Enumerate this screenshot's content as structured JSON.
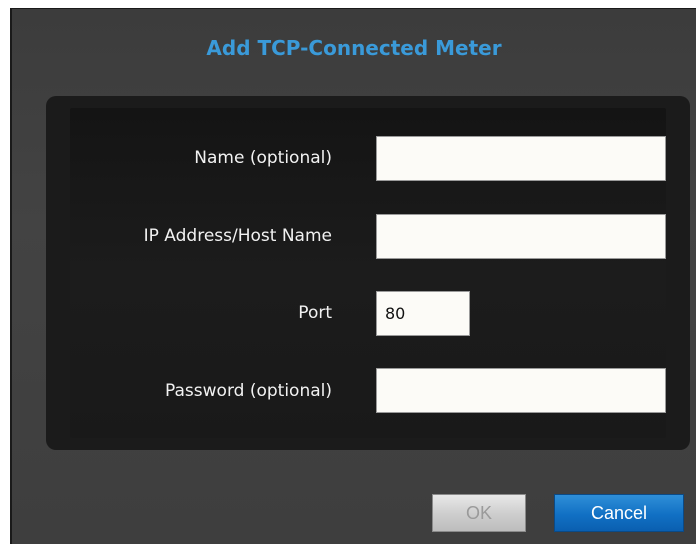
{
  "dialog": {
    "title": "Add TCP-Connected Meter"
  },
  "form": {
    "name_label": "Name (optional)",
    "name_value": "",
    "ip_label": "IP Address/Host Name",
    "ip_value": "",
    "port_label": "Port",
    "port_value": "80",
    "password_label": "Password (optional)",
    "password_value": ""
  },
  "buttons": {
    "ok_label": "OK",
    "cancel_label": "Cancel"
  },
  "colors": {
    "title": "#3a9ad9",
    "cancel_button": "#1170c4"
  }
}
